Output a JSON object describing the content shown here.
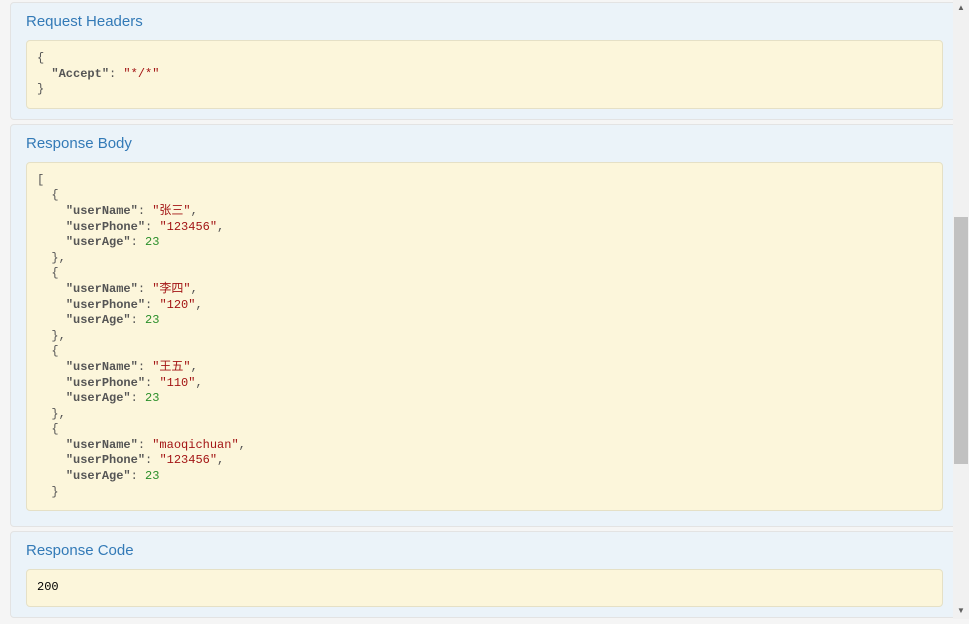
{
  "sections": {
    "requestHeaders": {
      "title": "Request Headers",
      "content": "{\n  \"Accept\": \"*/*\"\n}"
    },
    "responseBody": {
      "title": "Response Body",
      "data": [
        {
          "userName": "张三",
          "userPhone": "123456",
          "userAge": 23
        },
        {
          "userName": "李四",
          "userPhone": "120",
          "userAge": 23
        },
        {
          "userName": "王五",
          "userPhone": "110",
          "userAge": 23
        },
        {
          "userName": "maoqichuan",
          "userPhone": "123456",
          "userAge": 23
        }
      ]
    },
    "responseCode": {
      "title": "Response Code",
      "value": "200"
    }
  }
}
